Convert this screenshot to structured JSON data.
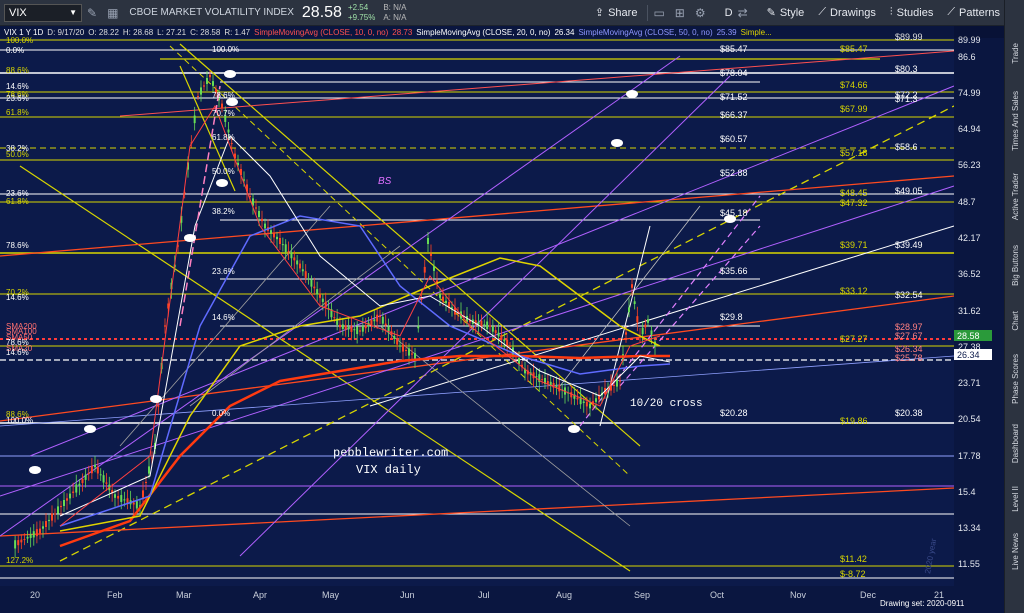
{
  "toolbar": {
    "symbol": "VIX",
    "instrument_name": "CBOE MARKET VOLATILITY INDEX",
    "last": "28.58",
    "change": "+2.54",
    "change_pct": "+9.75%",
    "bid": "B: N/A",
    "ask": "A: N/A",
    "share": "Share",
    "period": "D",
    "style": "Style",
    "drawings": "Drawings",
    "studies": "Studies",
    "patterns": "Patterns"
  },
  "legend": {
    "header": "VIX 1 Y 1D",
    "date": "D: 9/17/20",
    "open": "O: 28.22",
    "high": "H: 28.68",
    "low": "L: 27.21",
    "close": "C: 28.58",
    "range": "R: 1.47",
    "sma10": "SimpleMovingAvg (CLOSE, 10, 0, no)",
    "sma10_val": "28.73",
    "sma20": "SimpleMovingAvg (CLOSE, 20, 0, no)",
    "sma20_val": "26.34",
    "sma50": "SimpleMovingAvg (CLOSE, 50, 0, no)",
    "sma50_val": "25.39",
    "more": "Simple..."
  },
  "colors": {
    "background": "#0c1a4a",
    "fib_yellow": "#d8d600",
    "sma10": "#ff4040",
    "sma20": "#ffffff",
    "sma50": "#5f6bff",
    "sma100": "#e0d400",
    "sma200": "#ff3a10",
    "candle_up": "#66dd55",
    "candle_down": "#ff4422",
    "price_tag": "#2a9a3a"
  },
  "price_axis": [
    "89.99",
    "86.6",
    "74.99",
    "64.94",
    "56.23",
    "48.7",
    "42.17",
    "36.52",
    "31.62",
    "27.38",
    "23.71",
    "20.54",
    "17.78",
    "15.4",
    "13.34",
    "11.55"
  ],
  "price_tags": {
    "last": "28.58",
    "sma20": "26.34"
  },
  "x_axis": [
    "20",
    "Feb",
    "Mar",
    "Apr",
    "May",
    "Jun",
    "Jul",
    "Aug",
    "Sep",
    "Oct",
    "Nov",
    "Dec",
    "21"
  ],
  "fib_left_labels": [
    "100.0%",
    "0.0%",
    "88.6%",
    "14.6%",
    "78.6%",
    "23.6%",
    "61.8%",
    "38.2%",
    "50.0%",
    "23.6%",
    "61.8%",
    "78.6%",
    "70.2%",
    "14.6%",
    "SMA200",
    "SMA100",
    "SMA50",
    "78.6%",
    "SMA20",
    "14.6%",
    "88.6%",
    "100.0%",
    "127.2%"
  ],
  "fib_mid_labels": [
    "100.0%",
    "78.6%",
    "70.7%",
    "61.8%",
    "50.0%",
    "38.2%",
    "23.6%",
    "14.6%",
    "0.0%"
  ],
  "levels_mid": [
    "$85.47",
    "$78.04",
    "$71.52",
    "$66.37",
    "$60.57",
    "$52.88",
    "$45.18",
    "$35.66",
    "$29.8",
    "$20.28"
  ],
  "levels_right_yellow": [
    "$85.47",
    "$74.66",
    "$67.99",
    "$57.18",
    "$48.45",
    "$47.32",
    "$39.71",
    "$33.12",
    "$27.27",
    "$19.86",
    "$11.42",
    "$-8.72"
  ],
  "levels_far": [
    "$89.99",
    "$80.3",
    "$72.2",
    "$71.3",
    "$58.6",
    "$49.05",
    "$39.49",
    "$32.54",
    "$28.97",
    "$27.67",
    "$26.34",
    "$25.78",
    "$20.38"
  ],
  "annotations": {
    "bs": "BS",
    "cross": "10/20 cross",
    "watermark1": "pebblewriter.com",
    "watermark2": "VIX daily",
    "year_note": "2020 year"
  },
  "footer": {
    "drawing_set": "Drawing set: 2020-0911"
  },
  "sidebar": [
    "Trade",
    "Times And Sales",
    "Active Trader",
    "Big Buttons",
    "Chart",
    "Phase Scores",
    "Dashboard",
    "Level II",
    "Live News"
  ]
}
